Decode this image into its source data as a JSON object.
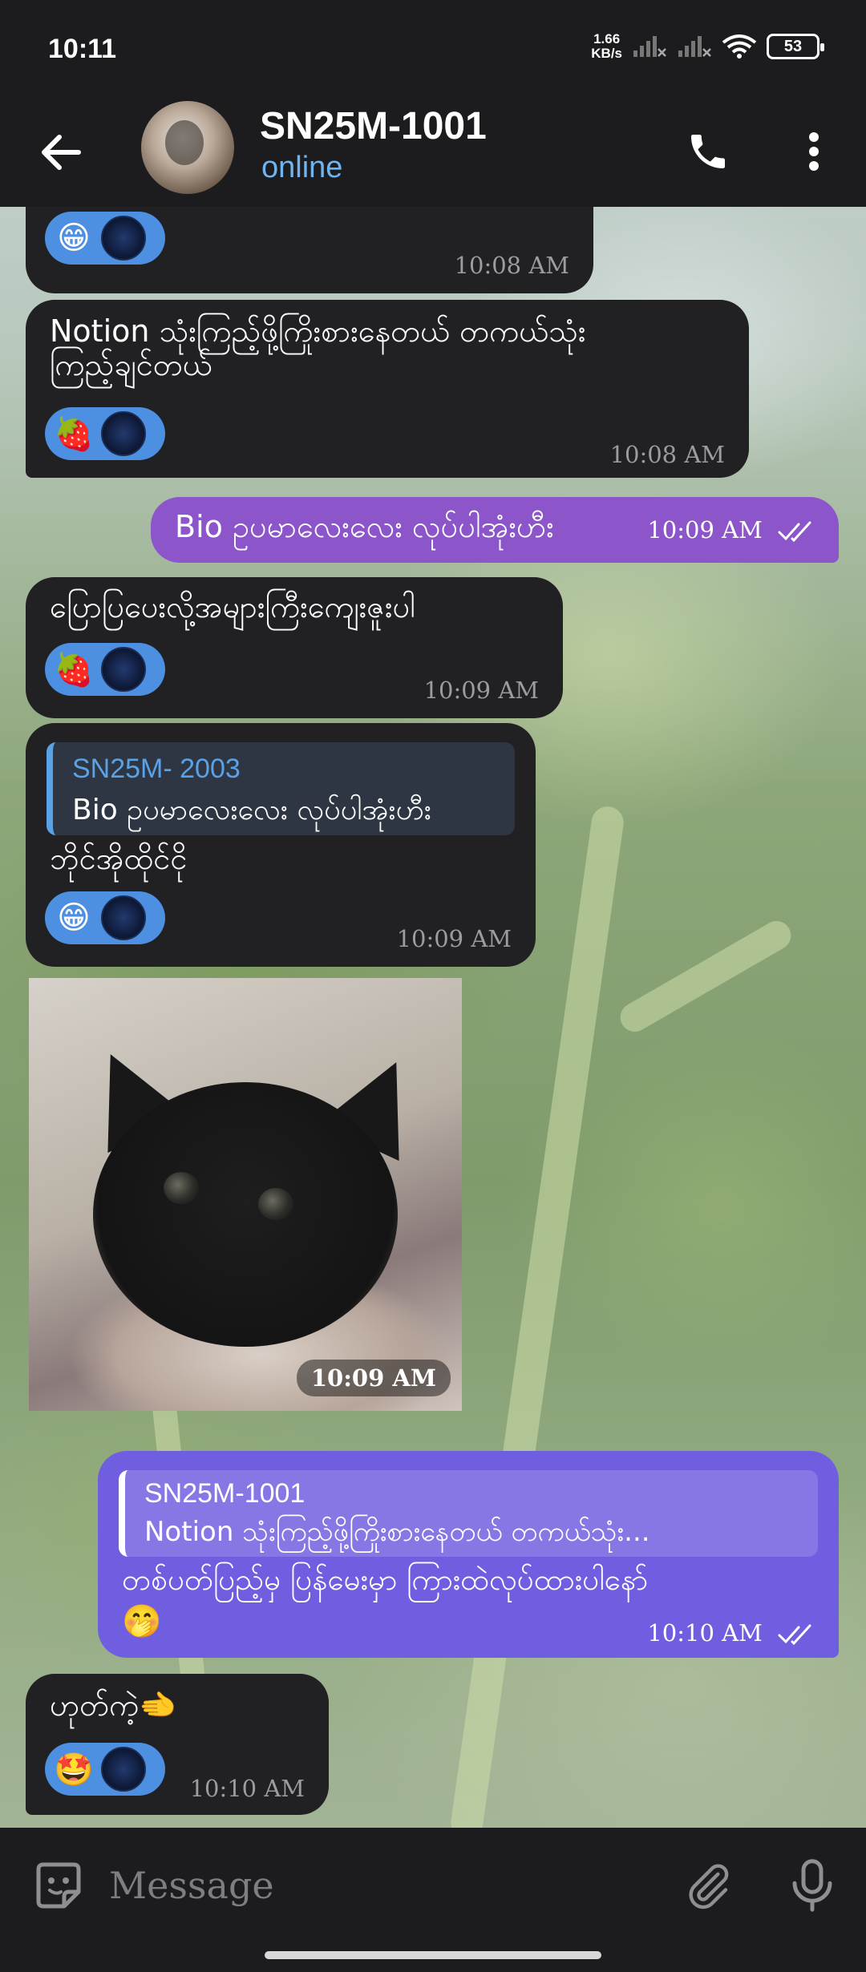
{
  "status_bar": {
    "time": "10:11",
    "net_speed_value": "1.66",
    "net_speed_unit": "KB/s",
    "battery": "53"
  },
  "header": {
    "title": "SN25M-1001",
    "status": "online"
  },
  "messages": [
    {
      "reaction": "😁",
      "time": "10:08 AM"
    },
    {
      "line1": "Notion သုံးကြည့်ဖို့ကြိုးစားနေတယ် တကယ်သုံး",
      "line2": "ကြည့်ချင်တယ်",
      "reaction": "🍓",
      "time": "10:08 AM"
    },
    {
      "text": "Bio ဥပမာလေးလေး လုပ်ပါအုံးဟီး",
      "time": "10:09 AM"
    },
    {
      "text": "ပြောပြပေးလို့အများကြီးကျေးဇူးပါ",
      "reaction": "🍓",
      "time": "10:09 AM"
    },
    {
      "reply_name": "SN25M- 2003",
      "reply_text": "Bio ဥပမာလေးလေး လုပ်ပါအုံးဟီး",
      "text": "ဘိုင်အိုထိုင်ငို",
      "reaction": "😁",
      "time": "10:09 AM"
    },
    {
      "photo_time": "10:09 AM"
    },
    {
      "reply_name": "SN25M-1001",
      "reply_text": "Notion သုံးကြည့်ဖို့ကြိုးစားနေတယ် တကယ်သုံး...",
      "text": "တစ်ပတ်ပြည့်မှ ပြန်မေးမှာ ကြားထဲလုပ်ထားပါနော်",
      "emoji": "🤭",
      "time": "10:10 AM"
    },
    {
      "text": "ဟုတ်ကဲ့🫲",
      "reaction": "🤩",
      "time": "10:10 AM"
    }
  ],
  "input": {
    "placeholder": "Message"
  },
  "colors": {
    "incoming_bubble": "#212124",
    "outgoing_bubble": "#8c55c9",
    "outgoing_reply_bubble": "#6f5ee0",
    "accent": "#6fb4f0",
    "reaction_pill": "#4d8fe0"
  },
  "icons": {
    "back": "arrow-left-icon",
    "call": "phone-icon",
    "menu": "more-vertical-icon",
    "emoji": "sticker-emoji-icon",
    "attach": "paperclip-icon",
    "mic": "microphone-icon"
  }
}
